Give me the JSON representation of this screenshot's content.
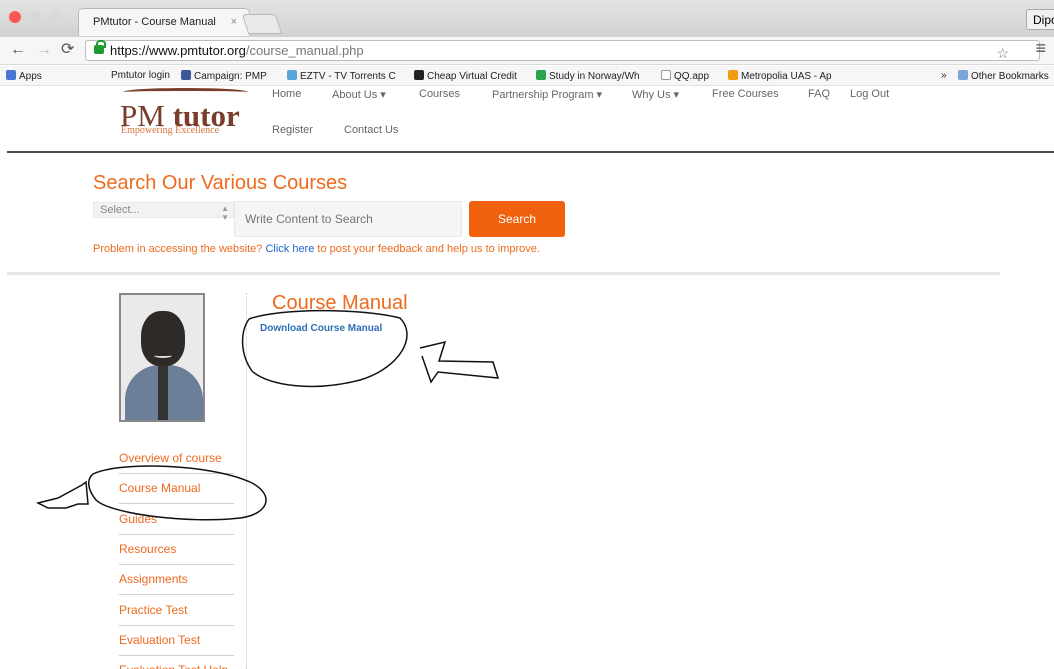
{
  "browser": {
    "tab_title": "PMtutor - Course Manual",
    "tab_close": "×",
    "profile": "Dipo",
    "url_host": "https://www.pmtutor.org",
    "url_path": "/course_manual.php",
    "bookmarks": [
      "Apps",
      "Pmtutor login",
      "Campaign: PMP",
      "EZTV - TV Torrents C",
      "Cheap Virtual Credit",
      "Study in Norway/Wh",
      "QQ.app",
      "Metropolia UAS - Ap",
      "»",
      "Other Bookmarks"
    ]
  },
  "logo": {
    "name_regular": "PM ",
    "name_bold": "tutor",
    "tagline": "Empowering Excellence"
  },
  "nav": {
    "home": "Home",
    "about": "About Us ▾",
    "courses": "Courses",
    "partnership": "Partnership Program ▾",
    "why": "Why Us ▾",
    "free": "Free Courses",
    "faq": "FAQ",
    "logout": "Log Out",
    "register": "Register",
    "contact": "Contact Us"
  },
  "search": {
    "title": "Search Our Various Courses",
    "select": "Select...",
    "placeholder": "Write Content to Search",
    "button": "Search"
  },
  "notice": {
    "before": "Problem in accessing the website? ",
    "link": "Click here",
    "after": " to post your feedback and help us to improve."
  },
  "sidebar": {
    "items": [
      "Overview of course",
      "Course Manual",
      "Guides",
      "Resources",
      "Assignments",
      "Practice Test",
      "Evaluation Test",
      "Evaluation Test Help"
    ]
  },
  "main": {
    "title": "Course Manual",
    "download": "Download Course Manual"
  },
  "colors": {
    "accent": "#ee6a1e",
    "button": "#f0610e",
    "link": "#1f67c9",
    "logo": "#7a3d2b"
  }
}
